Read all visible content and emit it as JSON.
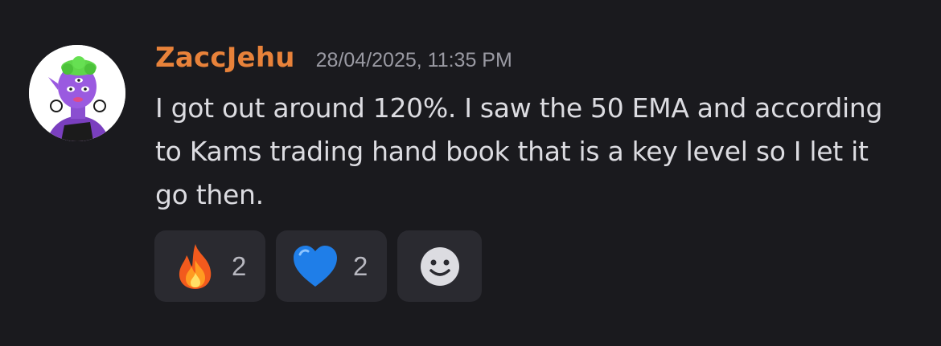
{
  "message": {
    "author": "ZaccJehu",
    "timestamp": "28/04/2025, 11:35 PM",
    "text": "I got out around 120%. I saw the 50 EMA and according to Kams trading hand book that is a key level so I let it go then."
  },
  "reactions": [
    {
      "icon": "fire-emoji-icon",
      "count": "2"
    },
    {
      "icon": "blue-heart-emoji-icon",
      "count": "2"
    }
  ],
  "add_reaction": {
    "icon": "smiley-face-icon"
  },
  "colors": {
    "background": "#1a1a1e",
    "username": "#e8823a",
    "timestamp": "#9a9aa3",
    "text": "#dcdce1",
    "reaction_bg": "#2a2a30"
  }
}
